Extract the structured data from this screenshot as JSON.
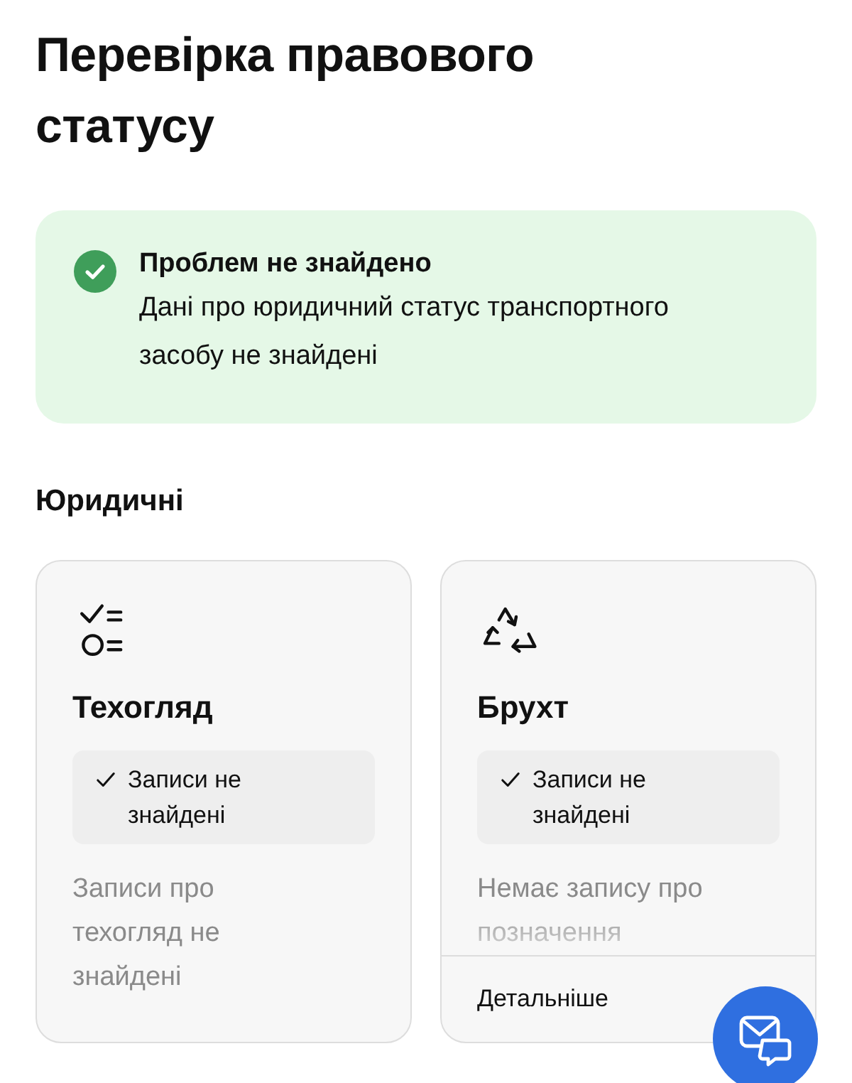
{
  "title": "Перевірка правового статусу",
  "status": {
    "title": "Проблем не знайдено",
    "text": "Дані про юридичний статус транспортного засобу не знайдені"
  },
  "section": {
    "heading": "Юридичні"
  },
  "cards": [
    {
      "kind": "inspection",
      "title": "Техогляд",
      "badge": "Записи не знайдені",
      "description": "Записи про техогляд не знайдені",
      "faded": false
    },
    {
      "kind": "scrap",
      "title": "Брухт",
      "badge": "Записи не знайдені",
      "description": "Немає запису про позначення",
      "faded": true,
      "more_link": "Детальніше"
    }
  ]
}
